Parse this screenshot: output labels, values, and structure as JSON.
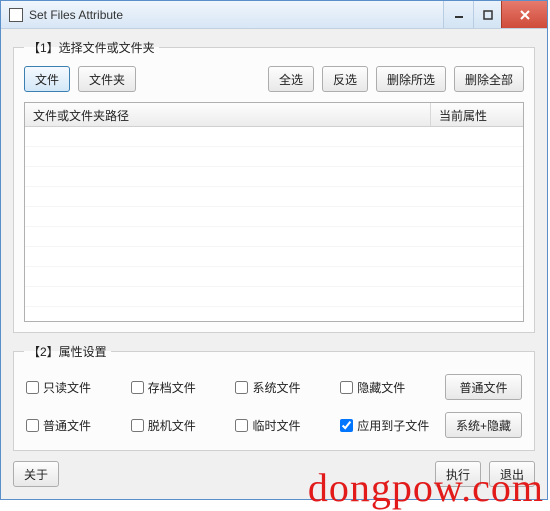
{
  "window": {
    "title": "Set Files Attribute"
  },
  "section1": {
    "legend": "【1】选择文件或文件夹",
    "buttons": {
      "file": "文件",
      "folder": "文件夹",
      "select_all": "全选",
      "invert": "反选",
      "delete_selected": "删除所选",
      "delete_all": "删除全部"
    },
    "columns": {
      "path": "文件或文件夹路径",
      "attr": "当前属性"
    }
  },
  "section2": {
    "legend": "【2】属性设置",
    "checks": {
      "readonly": "只读文件",
      "archive": "存档文件",
      "system": "系统文件",
      "hidden": "隐藏文件",
      "normal": "普通文件",
      "offline": "脱机文件",
      "temp": "临时文件",
      "apply_sub": "应用到子文件"
    },
    "preset_buttons": {
      "normal": "普通文件",
      "sys_hidden": "系统+隐藏"
    },
    "apply_sub_checked": true
  },
  "footer": {
    "about": "关于",
    "execute": "执行",
    "exit": "退出"
  },
  "watermark": "dongpow.com"
}
